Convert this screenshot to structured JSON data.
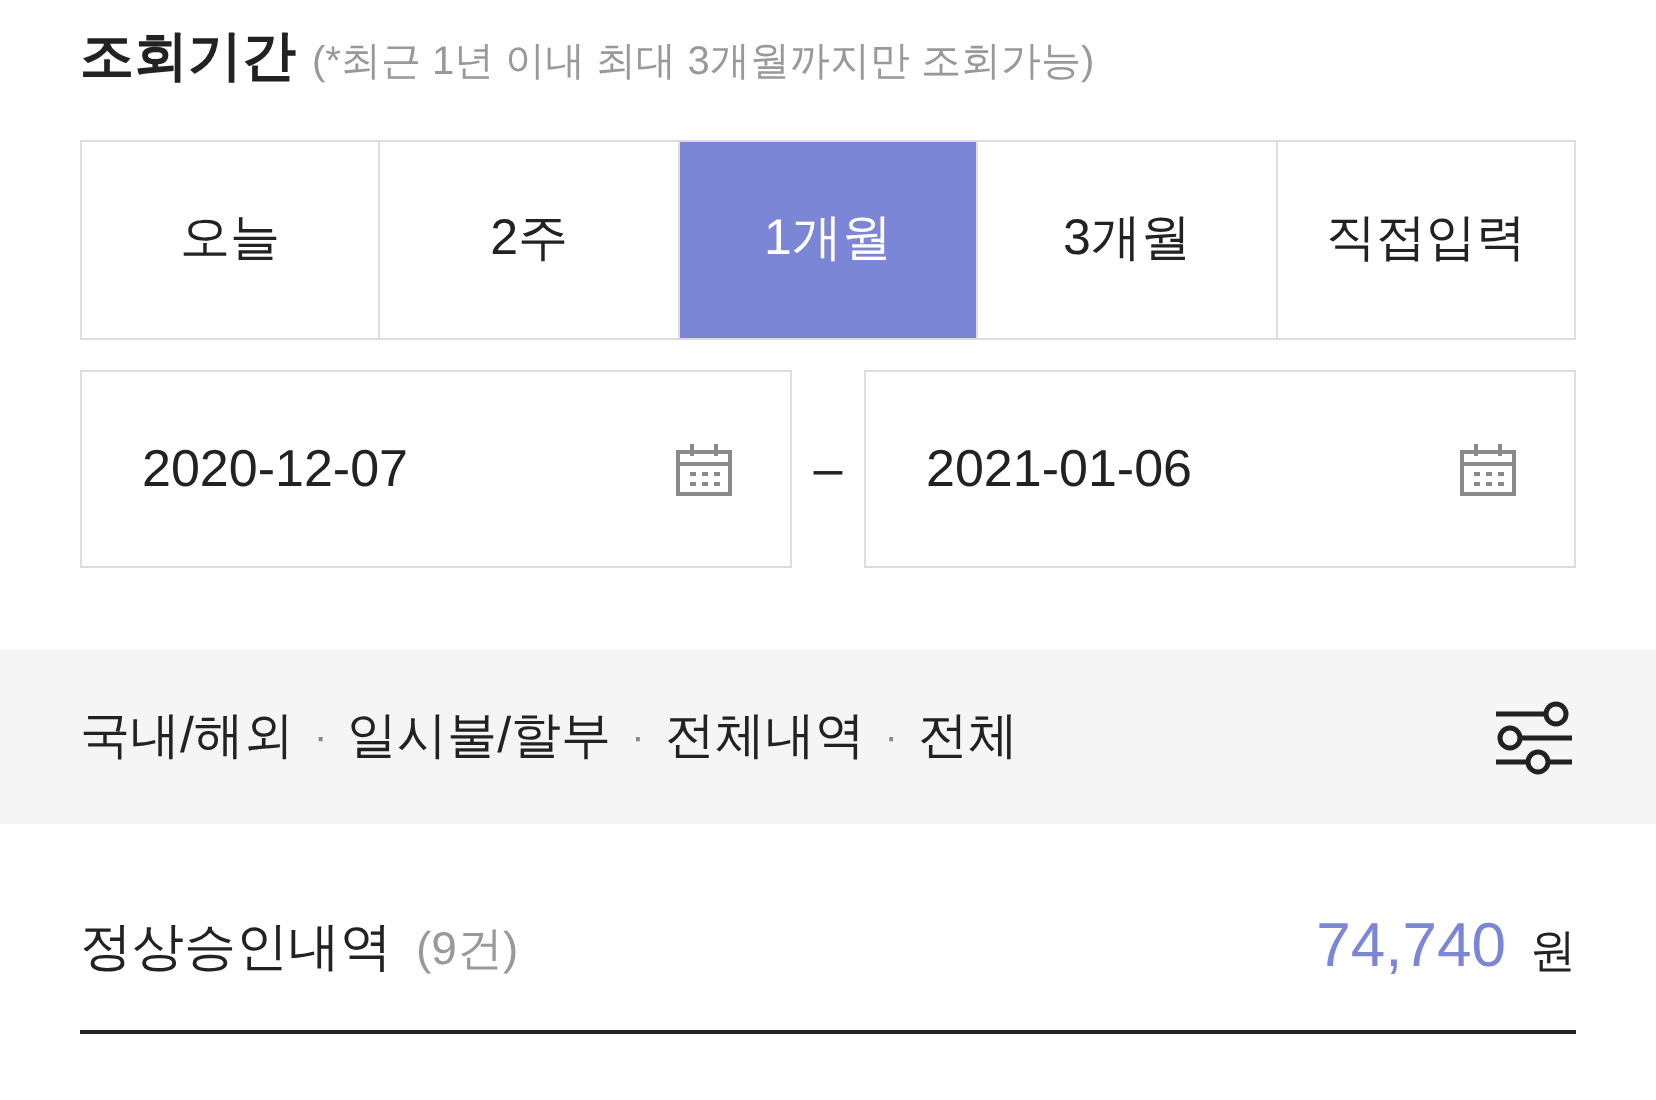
{
  "period": {
    "title": "조회기간",
    "note": "(*최근 1년 이내 최대 3개월까지만 조회가능)"
  },
  "tabs": [
    {
      "label": "오늘",
      "selected": false
    },
    {
      "label": "2주",
      "selected": false
    },
    {
      "label": "1개월",
      "selected": true
    },
    {
      "label": "3개월",
      "selected": false
    },
    {
      "label": "직접입력",
      "selected": false
    }
  ],
  "date_range": {
    "start": "2020-12-07",
    "separator": "–",
    "end": "2021-01-06"
  },
  "filters": {
    "items": [
      "국내/해외",
      "일시불/할부",
      "전체내역",
      "전체"
    ],
    "separator": "·"
  },
  "summary": {
    "label": "정상승인내역",
    "count": "(9건)",
    "amount": "74,740",
    "unit": "원"
  }
}
